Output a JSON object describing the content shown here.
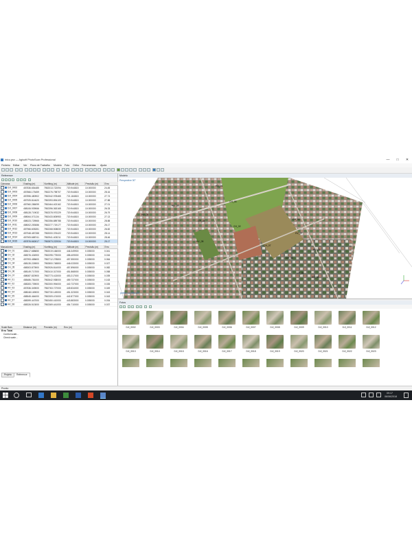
{
  "window": {
    "title": "inicu.psx — Agisoft PhotoScan Professional",
    "controls": [
      "—",
      "□",
      "✕"
    ]
  },
  "menu": [
    "Ficheiro",
    "Editar",
    "Ver",
    "Fluxo de Trabalho",
    "Modelo",
    "Foto",
    "Ortho",
    "Ferramentas",
    "Ajuda"
  ],
  "reference": {
    "title": "Reference",
    "camera_headers": [
      "Câmaras",
      "Easting (m)",
      "Northing (m)",
      "Altitude (m)",
      "Precisão (m)",
      "Erro"
    ],
    "cameras": [
      [
        "DJI_0002",
        "457836.654485",
        "7552013.722094",
        "720.944815",
        "10.000000",
        "24.45"
      ],
      [
        "DJI_0003",
        "457866.175459",
        "7552276.798707",
        "720.944815",
        "10.000000",
        "28.16"
      ],
      [
        "DJI_0004",
        "457896.480902",
        "7552342.978465",
        "721.184815",
        "10.000000",
        "27.74"
      ],
      [
        "DJI_0005",
        "457925.814620",
        "7552393.894109",
        "720.944815",
        "10.000000",
        "27.88"
      ],
      [
        "DJI_0006",
        "457960.286099",
        "7552464.402162",
        "720.944815",
        "10.000000",
        "27.01"
      ],
      [
        "DJI_0007",
        "458106.939066",
        "7552396.363165",
        "719.944815",
        "10.000000",
        "26.33"
      ],
      [
        "DJI_0008",
        "458128.719032",
        "7552378.970229",
        "720.944815",
        "10.000000",
        "26.79"
      ],
      [
        "DJI_0009",
        "458064.071134",
        "7552433.805953",
        "720.944815",
        "10.000000",
        "27.13"
      ],
      [
        "DJI_0010",
        "458023.725965",
        "7552356.889788",
        "720.944815",
        "10.000000",
        "28.88"
      ],
      [
        "DJI_0011",
        "458002.253086",
        "7552277.719177",
        "720.944815",
        "10.000000",
        "26.17"
      ],
      [
        "DJI_0012",
        "457966.605281",
        "7552268.508830",
        "720.944815",
        "10.000000",
        "26.82"
      ],
      [
        "DJI_0013",
        "457948.487288",
        "7552000.376422",
        "720.944815",
        "10.000000",
        "28.14"
      ],
      [
        "DJI_0014",
        "457905.688741",
        "7552941.403211",
        "720.944815",
        "10.000000",
        "28.46"
      ],
      [
        "DJI_0015",
        "457876.662617",
        "7552873.222534",
        "720.944815",
        "10.000000",
        "25.17"
      ]
    ],
    "marker_headers": [
      "Marcadores",
      "Easting (m)",
      "Northing (m)",
      "Altitude (m)",
      "Precisão (m)",
      "Erro"
    ],
    "markers": [
      [
        "CH_01",
        "458417.688650",
        "7552019.166000",
        "446.349900",
        "0.005000",
        "0.041"
      ],
      [
        "CH_02",
        "458376.434900",
        "7552295.775000",
        "458.409000",
        "0.005000",
        "0.016"
      ],
      [
        "CH_03",
        "457993.458600",
        "7552712.278800",
        "457.550000",
        "0.005000",
        "0.064"
      ],
      [
        "CH_04",
        "458135.226900",
        "7552800.748800",
        "446.033000",
        "0.005000",
        "0.027"
      ],
      [
        "CH_05",
        "458303.873900",
        "7552926.814000",
        "457.896000",
        "0.005000",
        "0.082"
      ],
      [
        "CH_06",
        "458149.717000",
        "7552410.317000",
        "451.868000",
        "0.005000",
        "0.058"
      ],
      [
        "CH_07",
        "458087.820900",
        "7552773.413000",
        "453.217000",
        "0.005000",
        "0.039"
      ],
      [
        "HV_01",
        "458486.781000",
        "7552642.938000",
        "459.737000",
        "0.005000",
        "0.163"
      ],
      [
        "HV_02",
        "458283.739000",
        "7552300.994000",
        "440.737000",
        "0.005000",
        "0.026"
      ],
      [
        "HV_03",
        "457836.349000",
        "7552763.727000",
        "449.834000",
        "0.005000",
        "0.049"
      ],
      [
        "HV_04",
        "458048.169000",
        "7552730.149000",
        "451.323000",
        "0.005000",
        "0.043"
      ],
      [
        "HV_05",
        "458545.464000",
        "7552309.474000",
        "442.877000",
        "0.005000",
        "0.043"
      ],
      [
        "HV_07",
        "458399.447000",
        "7552450.410000",
        "443.883000",
        "0.005000",
        "0.034"
      ],
      [
        "HV_08",
        "458326.513000",
        "7552369.441000",
        "454.710000",
        "0.005000",
        "0.037"
      ]
    ],
    "error_headers": [
      "Scale Bars",
      "Distance (m)",
      "Precisão (m)",
      "Erro (m)"
    ],
    "error_rows": [
      "Erro Total",
      "Control scale...",
      "Check scale..."
    ]
  },
  "left_tabs": [
    "Projeto",
    "Reference"
  ],
  "model": {
    "title": "Modelo",
    "perspective": "Perspective 30°",
    "points": "points: 12,459,130",
    "marker_labels": [
      "HV_01",
      "CH_05",
      "HV_03",
      "HV_04",
      "CH_04",
      "CH_02",
      "HV_05",
      "CH_03",
      "HV_07",
      "CH_07",
      "HV_02",
      "CH_06",
      "CH_01",
      "HV_08"
    ]
  },
  "photos": {
    "title": "Fotos",
    "row1": [
      "DJI_0002",
      "DJI_0003",
      "DJI_0004",
      "DJI_0005",
      "DJI_0006",
      "DJI_0007",
      "DJI_0008",
      "DJI_0009",
      "DJI_0010",
      "DJI_0011",
      "DJI_0012"
    ],
    "row2": [
      "DJI_0013",
      "DJI_0014",
      "DJI_0015",
      "DJI_0016",
      "DJI_0017",
      "DJI_0018",
      "DJI_0019",
      "DJI_0020",
      "DJI_0021",
      "DJI_0022",
      "DJI_0023"
    ]
  },
  "status": {
    "text": "Pronto"
  },
  "taskbar": {
    "time": "09:17",
    "date": "06/06/2018"
  },
  "colors": {
    "accent": "#2f6aa5",
    "selection": "#cfe3f7",
    "taskbar": "#1c1f24"
  }
}
